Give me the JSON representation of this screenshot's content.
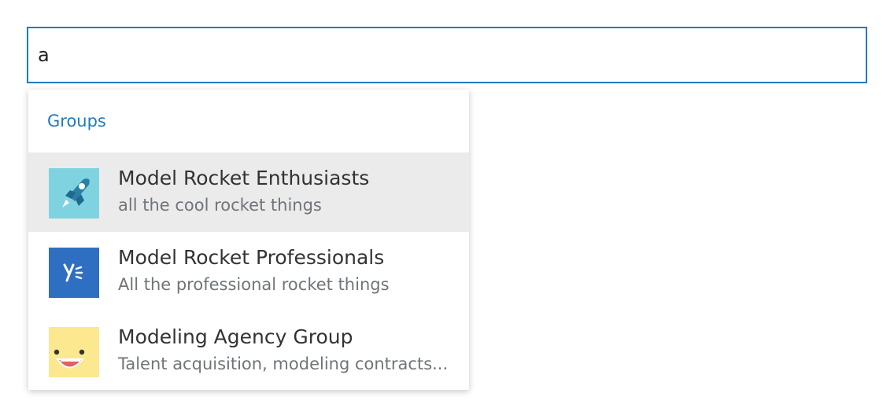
{
  "search": {
    "value": "a",
    "placeholder": ""
  },
  "dropdown": {
    "section_label": "Groups",
    "items": [
      {
        "title": "Model Rocket Enthusiasts",
        "description": "all the cool rocket things",
        "icon": "rocket-icon",
        "avatar_color": "#7fd3e0",
        "highlighted": true
      },
      {
        "title": "Model Rocket Professionals",
        "description": "All the professional rocket things",
        "icon": "yammer-logo-icon",
        "avatar_color": "#2f6fc2",
        "highlighted": false
      },
      {
        "title": "Modeling Agency Group",
        "description": "Talent acquisition, modeling contracts...",
        "icon": "smiley-face-icon",
        "avatar_color": "#fbe88f",
        "highlighted": false
      }
    ]
  },
  "colors": {
    "accent": "#1f7ac2",
    "highlight_row": "#ebebeb"
  }
}
